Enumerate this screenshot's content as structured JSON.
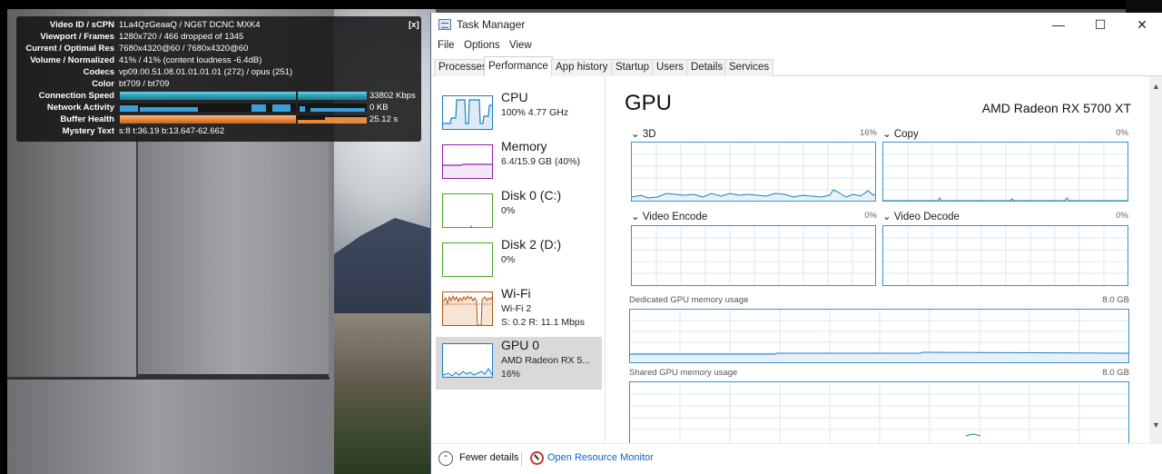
{
  "stats": {
    "close_label": "[x]",
    "rows": [
      {
        "label": "Video ID / sCPN",
        "value": "1La4QzGeaaQ / NG6T DCNC MXK4"
      },
      {
        "label": "Viewport / Frames",
        "value": "1280x720 / 466 dropped of 1345"
      },
      {
        "label": "Current / Optimal Res",
        "value": "7680x4320@60 / 7680x4320@60"
      },
      {
        "label": "Volume / Normalized",
        "value": "41% / 41% (content loudness -6.4dB)"
      },
      {
        "label": "Codecs",
        "value": "vp09.00.51.08.01.01.01.01 (272) / opus (251)"
      },
      {
        "label": "Color",
        "value": "bt709 / bt709"
      }
    ],
    "bars": [
      {
        "label": "Connection Speed",
        "value": "33802 Kbps"
      },
      {
        "label": "Network Activity",
        "value": "0 KB"
      },
      {
        "label": "Buffer Health",
        "value": "25.12 s"
      }
    ],
    "mystery": {
      "label": "Mystery Text",
      "value": "s:8 t:36.19 b:13.647-62.662"
    }
  },
  "taskmanager": {
    "title": "Task Manager",
    "window_buttons": {
      "minimize": "—",
      "maximize": "☐",
      "close": "✕"
    },
    "menu": [
      "File",
      "Options",
      "View"
    ],
    "tabs": [
      "Processes",
      "Performance",
      "App history",
      "Startup",
      "Users",
      "Details",
      "Services"
    ],
    "active_tab": "Performance",
    "sidebar": [
      {
        "title": "CPU",
        "sub1": "100% 4.77 GHz",
        "sub2": "",
        "color": "#1a7fc1"
      },
      {
        "title": "Memory",
        "sub1": "6.4/15.9 GB (40%)",
        "sub2": "",
        "color": "#8b1fa8"
      },
      {
        "title": "Disk 0 (C:)",
        "sub1": "0%",
        "sub2": "",
        "color": "#4ca62a"
      },
      {
        "title": "Disk 2 (D:)",
        "sub1": "0%",
        "sub2": "",
        "color": "#4ca62a"
      },
      {
        "title": "Wi-Fi",
        "sub1": "Wi-Fi 2",
        "sub2": "S: 0.2 R: 11.1 Mbps",
        "color": "#b8540e"
      },
      {
        "title": "GPU 0",
        "sub1": "AMD Radeon RX 5...",
        "sub2": "16%",
        "color": "#1a7fc1"
      }
    ],
    "gpu": {
      "title": "GPU",
      "name": "AMD Radeon RX 5700 XT",
      "engines": [
        {
          "label": "3D",
          "pct": "16%"
        },
        {
          "label": "Copy",
          "pct": "0%"
        },
        {
          "label": "Video Encode",
          "pct": "0%"
        },
        {
          "label": "Video Decode",
          "pct": "0%"
        }
      ],
      "dedicated_label": "Dedicated GPU memory usage",
      "dedicated_max": "8.0 GB",
      "shared_label": "Shared GPU memory usage",
      "shared_max": "8.0 GB"
    },
    "footer": {
      "fewer_details": "Fewer details",
      "resource_monitor": "Open Resource Monitor"
    }
  }
}
